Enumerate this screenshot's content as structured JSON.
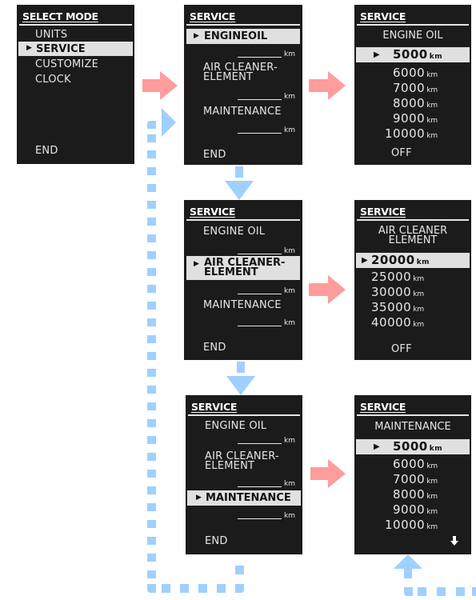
{
  "colors": {
    "screen_bg": "#1b1b1b",
    "highlight_bg": "#e0e0e0",
    "forward_arrow": "#ff9c9c",
    "return_arrow": "#9fd0ff"
  },
  "select_mode": {
    "title": "SELECT MODE",
    "items": [
      "UNITS",
      "SERVICE",
      "CUSTOMIZE",
      "CLOCK"
    ],
    "selected": "SERVICE",
    "end": "END"
  },
  "service_menu": {
    "title": "SERVICE",
    "engine_oil": "ENGINE OIL",
    "engine_oil_selected": "ENGINEOIL",
    "air_cleaner_line1": "AIR CLEANER-",
    "air_cleaner_line2": "ELEMENT",
    "maintenance": "MAINTENANCE",
    "unit": "km",
    "end": "END"
  },
  "engine_oil_options": {
    "title": "SERVICE",
    "heading": "ENGINE OIL",
    "selected": "5000",
    "options": [
      "5000",
      "6000",
      "7000",
      "8000",
      "9000",
      "10000"
    ],
    "unit": "km",
    "off": "OFF"
  },
  "air_cleaner_options": {
    "title": "SERVICE",
    "heading_line1": "AIR CLEANER",
    "heading_line2": "ELEMENT",
    "selected": "20000",
    "options": [
      "20000",
      "25000",
      "30000",
      "35000",
      "40000"
    ],
    "unit": "km",
    "off": "OFF"
  },
  "maintenance_options": {
    "title": "SERVICE",
    "heading": "MAINTENANCE",
    "selected": "5000",
    "options": [
      "5000",
      "6000",
      "7000",
      "8000",
      "9000",
      "10000"
    ],
    "unit": "km",
    "more_icon": "down-arrow-icon"
  },
  "icons": {
    "selector": "▶",
    "more": "🡇"
  }
}
